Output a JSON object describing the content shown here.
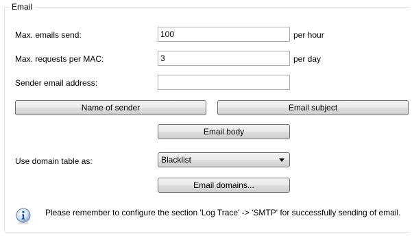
{
  "group": {
    "title": "Email"
  },
  "rows": {
    "max_emails": {
      "label": "Max. emails send:",
      "value": "100",
      "unit": "per hour"
    },
    "max_requests": {
      "label": "Max. requests per MAC:",
      "value": "3",
      "unit": "per day"
    },
    "sender_address": {
      "label": "Sender email address:",
      "value": ""
    }
  },
  "buttons": {
    "name_of_sender": "Name of sender",
    "email_subject": "Email subject",
    "email_body": "Email body",
    "email_domains": "Email domains..."
  },
  "domain_table": {
    "label": "Use domain table as:",
    "selected": "Blacklist"
  },
  "info": {
    "icon": "info-icon",
    "text": "Please remember to configure the section 'Log  Trace' -> 'SMTP' for successfully sending of email."
  }
}
